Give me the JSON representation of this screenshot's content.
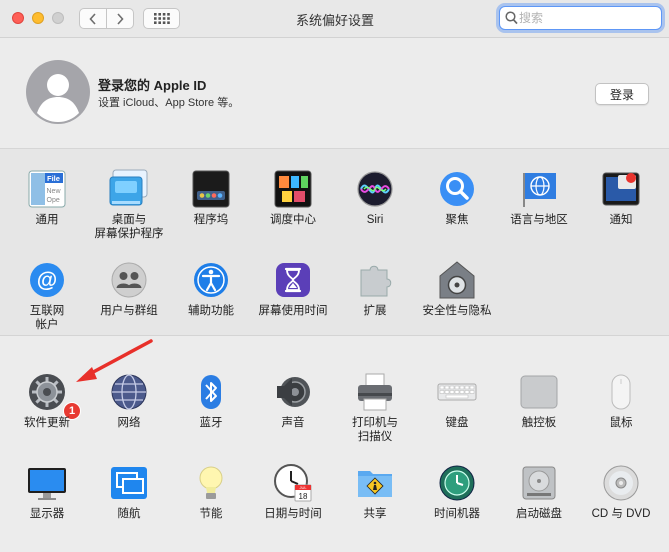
{
  "window": {
    "title": "系统偏好设置",
    "search_placeholder": "搜索"
  },
  "apple_id": {
    "title": "登录您的 Apple ID",
    "subtitle": "设置 iCloud、App Store 等。",
    "signin_label": "登录"
  },
  "section1": {
    "row1": [
      {
        "label": "通用",
        "icon": "general-icon"
      },
      {
        "label": "桌面与\n屏幕保护程序",
        "icon": "desktop-screensaver-icon"
      },
      {
        "label": "程序坞",
        "icon": "dock-icon"
      },
      {
        "label": "调度中心",
        "icon": "mission-control-icon"
      },
      {
        "label": "Siri",
        "icon": "siri-icon"
      },
      {
        "label": "聚焦",
        "icon": "spotlight-icon"
      },
      {
        "label": "语言与地区",
        "icon": "language-region-icon"
      },
      {
        "label": "通知",
        "icon": "notifications-icon"
      }
    ],
    "row2": [
      {
        "label": "互联网\n帐户",
        "icon": "internet-accounts-icon"
      },
      {
        "label": "用户与群组",
        "icon": "users-groups-icon"
      },
      {
        "label": "辅助功能",
        "icon": "accessibility-icon"
      },
      {
        "label": "屏幕使用时间",
        "icon": "screen-time-icon"
      },
      {
        "label": "扩展",
        "icon": "extensions-icon"
      },
      {
        "label": "安全性与隐私",
        "icon": "security-privacy-icon"
      }
    ]
  },
  "section2": {
    "row1": [
      {
        "label": "软件更新",
        "icon": "software-update-icon",
        "badge": "1"
      },
      {
        "label": "网络",
        "icon": "network-icon"
      },
      {
        "label": "蓝牙",
        "icon": "bluetooth-icon"
      },
      {
        "label": "声音",
        "icon": "sound-icon"
      },
      {
        "label": "打印机与\n扫描仪",
        "icon": "printers-scanners-icon"
      },
      {
        "label": "键盘",
        "icon": "keyboard-icon"
      },
      {
        "label": "触控板",
        "icon": "trackpad-icon"
      },
      {
        "label": "鼠标",
        "icon": "mouse-icon"
      }
    ],
    "row2": [
      {
        "label": "显示器",
        "icon": "displays-icon"
      },
      {
        "label": "随航",
        "icon": "sidecar-icon"
      },
      {
        "label": "节能",
        "icon": "energy-saver-icon"
      },
      {
        "label": "日期与时间",
        "icon": "date-time-icon"
      },
      {
        "label": "共享",
        "icon": "sharing-icon"
      },
      {
        "label": "时间机器",
        "icon": "time-machine-icon"
      },
      {
        "label": "启动磁盘",
        "icon": "startup-disk-icon"
      },
      {
        "label": "CD 与 DVD",
        "icon": "cd-dvd-icon"
      }
    ]
  },
  "icon_text": {
    "general_file": "File",
    "general_new": "New",
    "general_ope": "Ope",
    "calendar_month": "JUL",
    "calendar_day": "18"
  },
  "colors": {
    "accent": "#5e97f6",
    "badge": "#e83a32",
    "annotation_arrow": "#e8302a"
  }
}
